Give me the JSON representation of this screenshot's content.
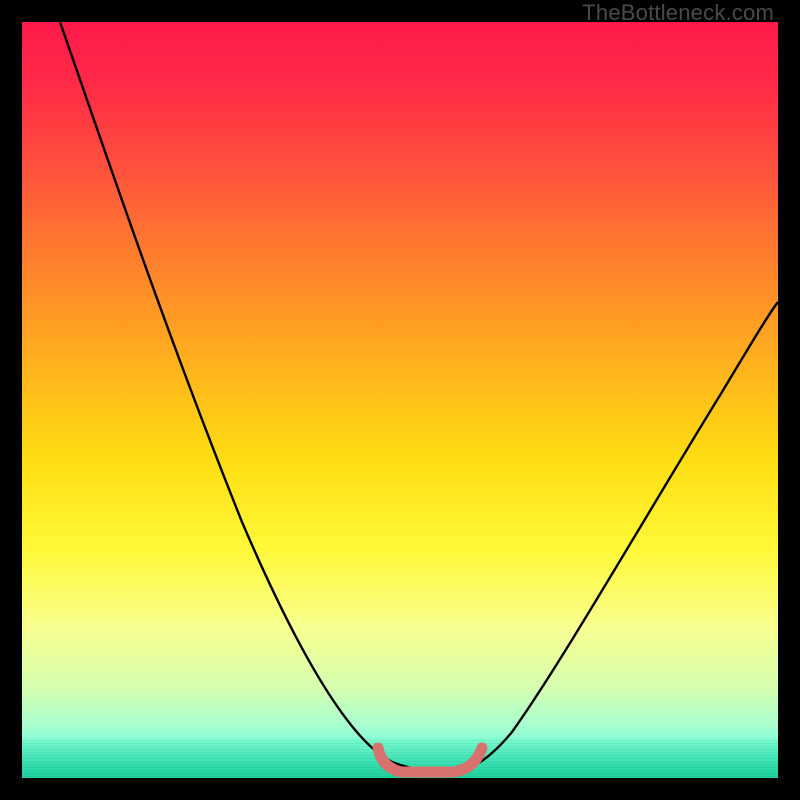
{
  "watermark": "TheBottleneck.com",
  "chart_data": {
    "type": "line",
    "title": "",
    "xlabel": "",
    "ylabel": "",
    "xlim": [
      0,
      100
    ],
    "ylim": [
      0,
      100
    ],
    "grid": false,
    "background_gradient": {
      "direction": "vertical",
      "stops": [
        {
          "pos": 0,
          "color": "#ff1a4b"
        },
        {
          "pos": 18,
          "color": "#ff4c3e"
        },
        {
          "pos": 44,
          "color": "#ffad1f"
        },
        {
          "pos": 70,
          "color": "#fff93a"
        },
        {
          "pos": 88,
          "color": "#d6ffb0"
        },
        {
          "pos": 100,
          "color": "#20d8ae"
        }
      ]
    },
    "series": [
      {
        "name": "bottleneck-curve",
        "color": "#000000",
        "x": [
          5,
          10,
          15,
          20,
          25,
          30,
          35,
          40,
          45,
          48,
          50,
          52,
          55,
          58,
          60,
          65,
          70,
          75,
          80,
          85,
          90,
          95,
          100
        ],
        "y": [
          100,
          88,
          76,
          64,
          52,
          40,
          30,
          20,
          10,
          5,
          2,
          0,
          0,
          0,
          2,
          8,
          16,
          24,
          32,
          40,
          48,
          55,
          62
        ]
      },
      {
        "name": "optimal-zone-marker",
        "color": "#d6716e",
        "x": [
          48,
          50,
          52,
          54,
          56,
          58,
          60
        ],
        "y": [
          3,
          1,
          0,
          0,
          0,
          1,
          3
        ]
      }
    ],
    "annotations": []
  }
}
